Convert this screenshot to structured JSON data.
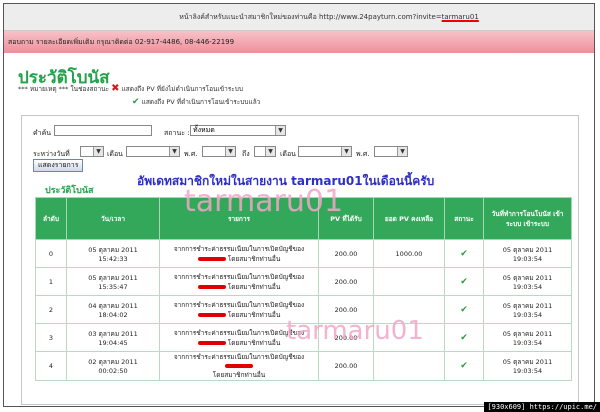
{
  "topbar": {
    "text_prefix": "หน้าลิงค์สำหรับแนะนำสมาชิกใหม่ของท่านคือ http://www.24payturn.com?invite=",
    "text_highlight": "tarmaru01"
  },
  "contact": {
    "text": "สอบถาม รายละเอียดเพิ่มเติม กรุณาติดต่อ 02-917-4486, 08-446-22199"
  },
  "page_title": "ประวัติโบนัส",
  "notes": {
    "line1_prefix": "*** หมายเหตุ ***  ในช่องสถานะ",
    "line1_suffix": "แสดงถึง PV ที่ยังไม่ดำเนินการโอนเข้าระบบ",
    "line2_suffix": "แสดงถึง PV ที่ดำเนินการโอนเข้าระบบแล้ว",
    "x_symbol": "✖",
    "check_symbol": "✔"
  },
  "filters": {
    "keyword_label": "คำค้น",
    "status_label": "สถานะ :",
    "status_value": "ทั้งหมด",
    "range_label": "ระหว่างวันที่",
    "month_label": "เดือน",
    "year_label": "พ.ศ.",
    "to_label": "ถึง",
    "show_button": "แสดงรายการ"
  },
  "section_title": "ประวัติโบนัส",
  "headline": "อัพเดทสมาชิกใหม่ในสายงาน   tarmaru01ในเดือนนี้ครับ",
  "watermark": "tarmaru01",
  "table": {
    "headers": [
      "ลำดับ",
      "วัน/เวลา",
      "รายการ",
      "PV ที่ได้รับ",
      "ยอด PV คงเหลือ",
      "สถานะ",
      "วันที่ทำการโอนโบนัส เข้าระบบ เข้าระบบ"
    ],
    "rows": [
      {
        "no": "0",
        "date": "05 ตุลาคม 2011",
        "time": "15:42:33",
        "desc1": "จากการชำระค่าธรรมเนียมในการเปิดบัญชีของ",
        "desc2": "โดยสมาชิกท่านอื่น",
        "pv": "200.00",
        "balance": "1000.00",
        "status": "✔",
        "tdate": "05 ตุลาคม 2011",
        "ttime": "19:03:54"
      },
      {
        "no": "1",
        "date": "05 ตุลาคม 2011",
        "time": "15:35:47",
        "desc1": "จากการชำระค่าธรรมเนียมในการเปิดบัญชีของ",
        "desc2": "โดยสมาชิกท่านอื่น",
        "pv": "200.00",
        "balance": "",
        "status": "✔",
        "tdate": "05 ตุลาคม 2011",
        "ttime": "19:03:54"
      },
      {
        "no": "2",
        "date": "04 ตุลาคม 2011",
        "time": "18:04:02",
        "desc1": "จากการชำระค่าธรรมเนียมในการเปิดบัญชีของ",
        "desc2": "โดยสมาชิกท่านอื่น",
        "pv": "200.00",
        "balance": "",
        "status": "✔",
        "tdate": "05 ตุลาคม 2011",
        "ttime": "19:03:54"
      },
      {
        "no": "3",
        "date": "03 ตุลาคม 2011",
        "time": "19:04:45",
        "desc1": "จากการชำระค่าธรรมเนียมในการเปิดบัญชีของ",
        "desc2": "โดยสมาชิกท่านอื่น",
        "pv": "200.00",
        "balance": "",
        "status": "✔",
        "tdate": "05 ตุลาคม 2011",
        "ttime": "19:03:54"
      },
      {
        "no": "4",
        "date": "02 ตุลาคม 2011",
        "time": "00:02:50",
        "desc1": "จากการชำระค่าธรรมเนียมในการเปิดบัญชีของ",
        "desc2": "โดยสมาชิกท่านอื่น",
        "pv": "200.00",
        "balance": "",
        "status": "✔",
        "tdate": "05 ตุลาคม 2011",
        "ttime": "19:03:54"
      }
    ]
  },
  "stamp": "[930x609] https://upic.me/",
  "colors": {
    "accent_green": "#22a24a",
    "header_green": "#34a85a",
    "headline_blue": "#2d2ec9",
    "watermark_pink": "#f2a6c8"
  }
}
